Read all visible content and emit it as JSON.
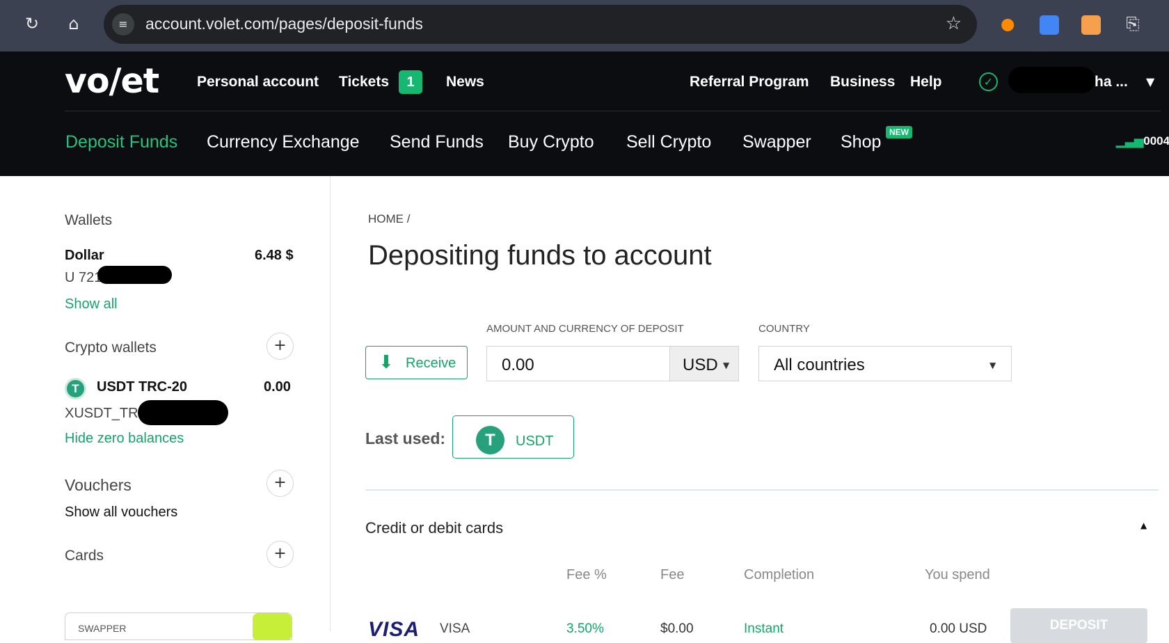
{
  "browser": {
    "url": "account.volet.com/pages/deposit-funds",
    "reload_icon": "reload-icon",
    "home_icon": "home-icon",
    "star_icon": "star-icon"
  },
  "topnav": {
    "logo": "vo/et",
    "personal_account": "Personal account",
    "tickets": "Tickets",
    "tickets_count": "1",
    "news": "News",
    "referral": "Referral Program",
    "business": "Business",
    "help": "Help",
    "user_name": "ha ...",
    "accent": "#16b871"
  },
  "subnav": {
    "items": [
      "Deposit Funds",
      "Currency Exchange",
      "Send Funds",
      "Buy Crypto",
      "Sell Crypto",
      "Swapper",
      "Shop"
    ],
    "new_badge": "NEW",
    "stats_value": "0004"
  },
  "sidebar": {
    "wallets_title": "Wallets",
    "dollar_name": "Dollar",
    "dollar_value": "6.48 $",
    "dollar_account": "U 721",
    "show_all": "Show all",
    "crypto_title": "Crypto wallets",
    "usdt_name": "USDT TRC-20",
    "usdt_value": "0.00",
    "usdt_account": "XUSDT_TRX9",
    "hide_zero": "Hide zero balances",
    "vouchers_title": "Vouchers",
    "show_vouchers": "Show all vouchers",
    "cards_title": "Cards",
    "swapper_label": "SWAPPER"
  },
  "main": {
    "breadcrumb": "HOME /",
    "title": "Depositing funds to account",
    "amount_label": "AMOUNT AND CURRENCY OF DEPOSIT",
    "country_label": "COUNTRY",
    "receive_button": "Receive",
    "amount_value": "0.00",
    "currency_value": "USD",
    "country_value": "All countries",
    "last_used_label": "Last used:",
    "last_used_currency": "USDT",
    "section_title": "Credit or debit cards",
    "columns": [
      "Fee %",
      "Fee",
      "Completion",
      "You spend"
    ],
    "row": {
      "logo": "VISA",
      "name": "VISA",
      "fee_percent": "3.50%",
      "fee": "$0.00",
      "completion": "Instant",
      "you_spend": "0.00 USD",
      "action": "DEPOSIT"
    }
  }
}
